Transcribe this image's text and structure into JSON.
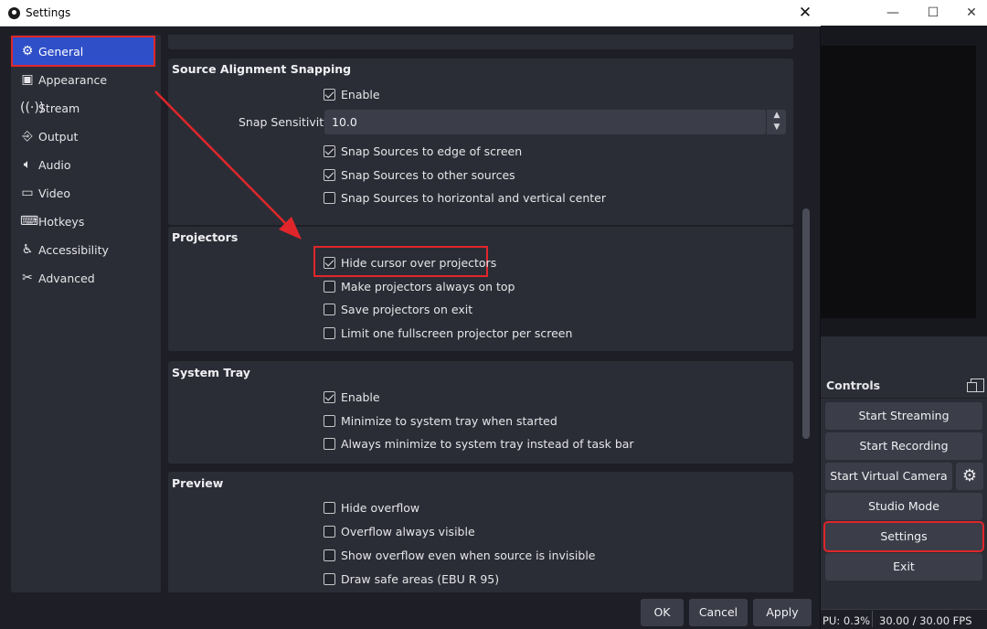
{
  "main_window": {
    "controls": {
      "title": "Controls",
      "buttons": {
        "start_streaming": "Start Streaming",
        "start_recording": "Start Recording",
        "start_virtual_camera": "Start Virtual Camera",
        "studio_mode": "Studio Mode",
        "settings": "Settings",
        "exit": "Exit"
      }
    },
    "status": {
      "cpu": "PU: 0.3%",
      "fps": "30.00 / 30.00 FPS"
    }
  },
  "dialog": {
    "title": "Settings",
    "sidebar": {
      "items": [
        {
          "label": "General",
          "icon": "gear-icon",
          "active": true
        },
        {
          "label": "Appearance",
          "icon": "palette-icon",
          "active": false
        },
        {
          "label": "Stream",
          "icon": "broadcast-icon",
          "active": false
        },
        {
          "label": "Output",
          "icon": "output-icon",
          "active": false
        },
        {
          "label": "Audio",
          "icon": "speaker-icon",
          "active": false
        },
        {
          "label": "Video",
          "icon": "monitor-icon",
          "active": false
        },
        {
          "label": "Hotkeys",
          "icon": "keyboard-icon",
          "active": false
        },
        {
          "label": "Accessibility",
          "icon": "accessibility-icon",
          "active": false
        },
        {
          "label": "Advanced",
          "icon": "wrench-icon",
          "active": false
        }
      ]
    },
    "snapping": {
      "title": "Source Alignment Snapping",
      "enable": {
        "label": "Enable",
        "checked": true
      },
      "sensitivity_label": "Snap Sensitivity",
      "sensitivity_value": "10.0",
      "edge": {
        "label": "Snap Sources to edge of screen",
        "checked": true
      },
      "other": {
        "label": "Snap Sources to other sources",
        "checked": true
      },
      "center": {
        "label": "Snap Sources to horizontal and vertical center",
        "checked": false
      }
    },
    "projectors": {
      "title": "Projectors",
      "hide_cursor": {
        "label": "Hide cursor over projectors",
        "checked": true
      },
      "always_on_top": {
        "label": "Make projectors always on top",
        "checked": false
      },
      "save_on_exit": {
        "label": "Save projectors on exit",
        "checked": false
      },
      "limit_one": {
        "label": "Limit one fullscreen projector per screen",
        "checked": false
      }
    },
    "system_tray": {
      "title": "System Tray",
      "enable": {
        "label": "Enable",
        "checked": true
      },
      "minimize_started": {
        "label": "Minimize to system tray when started",
        "checked": false
      },
      "always_minimize": {
        "label": "Always minimize to system tray instead of task bar",
        "checked": false
      }
    },
    "preview": {
      "title": "Preview",
      "hide_overflow": {
        "label": "Hide overflow",
        "checked": false
      },
      "overflow_visible": {
        "label": "Overflow always visible",
        "checked": false
      },
      "show_overflow_invisible": {
        "label": "Show overflow even when source is invisible",
        "checked": false
      },
      "safe_areas": {
        "label": "Draw safe areas (EBU R 95)",
        "checked": false
      }
    },
    "footer": {
      "ok": "OK",
      "cancel": "Cancel",
      "apply": "Apply"
    }
  },
  "colors": {
    "annotation_red": "#e0262a",
    "active_blue": "#2f4fc9"
  }
}
